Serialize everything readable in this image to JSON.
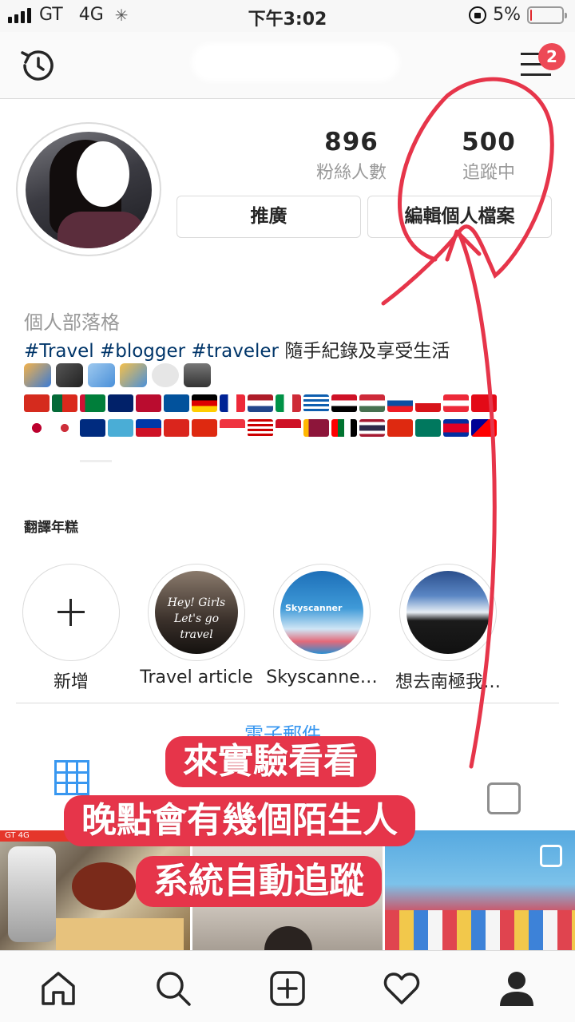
{
  "status_bar": {
    "carrier": "GT",
    "network": "4G",
    "time": "下午3:02",
    "battery": "5%",
    "battery_level": 0.05
  },
  "nav": {
    "history_icon": "history-icon",
    "menu_icon": "hamburger-menu-icon",
    "menu_badge": "2"
  },
  "profile": {
    "followers_count": "896",
    "followers_label": "粉絲人數",
    "following_count": "500",
    "following_label": "追蹤中",
    "promote_button": "推廣",
    "edit_profile_button": "編輯個人檔案",
    "category": "個人部落格",
    "bio_tags": "#Travel #blogger #traveler",
    "bio_text": "隨手紀錄及享受生活",
    "translate_label": "翻譯年糕"
  },
  "highlights": [
    {
      "label": "新增"
    },
    {
      "label": "Travel article",
      "image_text": "Hey! Girls Let's go travel"
    },
    {
      "label": "Skyscanne…",
      "image_text": "Skyscanner"
    },
    {
      "label": "想去南極我…"
    }
  ],
  "email_link": "電子郵件",
  "annotation": {
    "line1": "來實驗看看",
    "line2": "晚點會有幾個陌生人",
    "line3": "系統自動追蹤",
    "color": "#e6354a"
  },
  "photo_grid": {
    "p1_status": "GT  4G"
  },
  "bottom_nav": [
    "home-icon",
    "search-icon",
    "add-post-icon",
    "heart-icon",
    "profile-icon"
  ],
  "colors": {
    "accent_blue": "#3897f0",
    "badge_red": "#ed4956",
    "hashtag": "#003569"
  }
}
